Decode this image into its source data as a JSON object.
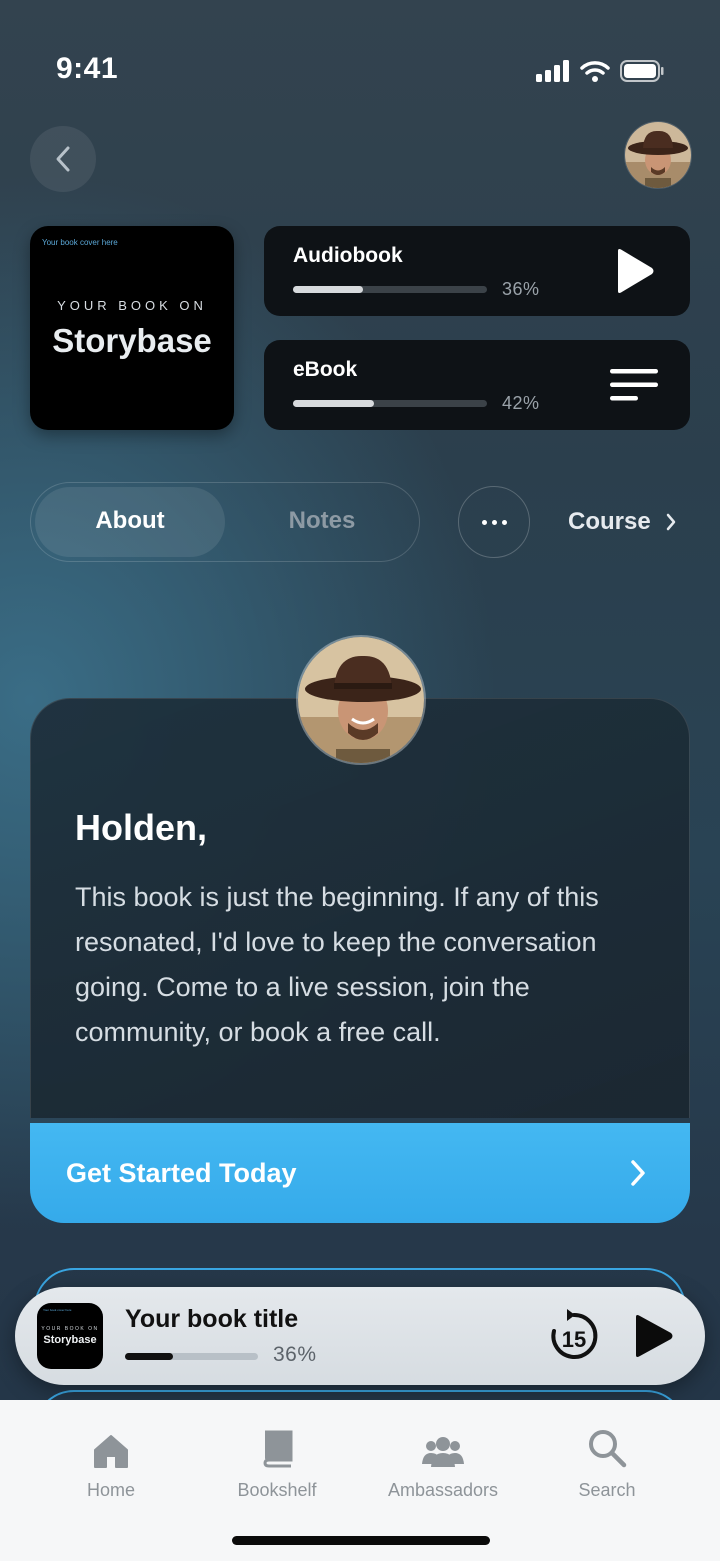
{
  "status_bar": {
    "time": "9:41"
  },
  "book": {
    "cover_note": "Your book cover here",
    "cover_kicker": "YOUR BOOK ON",
    "cover_title": "Storybase"
  },
  "media": [
    {
      "label": "Audiobook",
      "progress_percent": 36,
      "progress_label": "36%",
      "action_icon": "play-icon"
    },
    {
      "label": "eBook",
      "progress_percent": 42,
      "progress_label": "42%",
      "action_icon": "menu-lines-icon"
    }
  ],
  "tabs": {
    "items": [
      {
        "label": "About",
        "active": true
      },
      {
        "label": "Notes",
        "active": false
      }
    ],
    "more_icon": "more-dots-icon",
    "course_label": "Course"
  },
  "message": {
    "heading": "Holden,",
    "body": "This book is just the beginning. If any of this resonated, I'd love to keep the conversation going. Come to a live session, join the community, or book a free call.",
    "cta_label": "Get Started Today"
  },
  "mini_player": {
    "title": "Your book title",
    "progress_percent": 36,
    "progress_label": "36%",
    "cover_kicker": "YOUR BOOK ON",
    "cover_title": "Storybase",
    "cover_note": "Your book cover here",
    "skip_seconds": "15"
  },
  "tab_bar": [
    {
      "label": "Home",
      "icon": "home-icon"
    },
    {
      "label": "Bookshelf",
      "icon": "book-icon"
    },
    {
      "label": "Ambassadors",
      "icon": "people-icon"
    },
    {
      "label": "Search",
      "icon": "search-icon"
    }
  ],
  "colors": {
    "accent": "#3aaeec",
    "card_dark": "#0e1216",
    "tab_bar_bg": "#f6f7f8"
  }
}
